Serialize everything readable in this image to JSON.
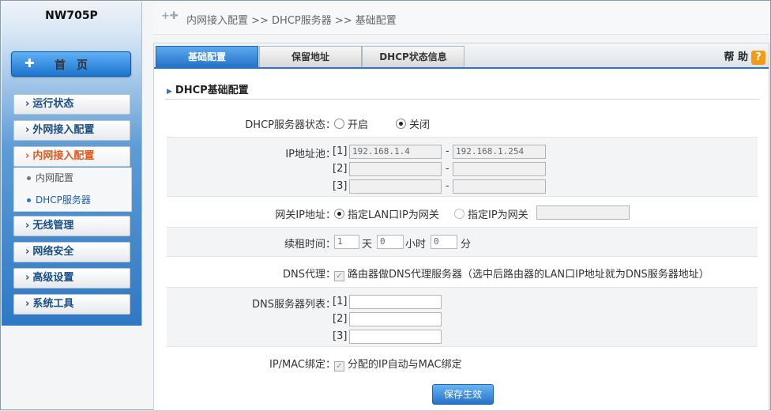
{
  "sidebar": {
    "logo": "NW705P",
    "home": {
      "icon": "plus-icon",
      "label": "首页"
    },
    "items": [
      {
        "label": "运行状态"
      },
      {
        "label": "外网接入配置"
      },
      {
        "label": "内网接入配置"
      },
      {
        "label": "无线管理"
      },
      {
        "label": "网络安全"
      },
      {
        "label": "高级设置"
      },
      {
        "label": "系统工具"
      }
    ],
    "arrow": "›",
    "subitems": [
      {
        "label": "内网配置"
      },
      {
        "label": "DHCP服务器"
      }
    ]
  },
  "breadcrumb": {
    "icon": "+✚",
    "text": "内网接入配置  >>  DHCP服务器  >>  基础配置"
  },
  "tabs": [
    {
      "label": "基础配置"
    },
    {
      "label": "保留地址"
    },
    {
      "label": "DHCP状态信息"
    }
  ],
  "help": {
    "label": "帮 助",
    "icon": "?"
  },
  "section": {
    "title": "DHCP基础配置",
    "tri": "▶"
  },
  "form": {
    "server_status": {
      "label": "DHCP服务器状态：",
      "on": "开启",
      "off": "关闭"
    },
    "ip_pool": {
      "label": "IP地址池：",
      "rows": [
        {
          "index": "[1]",
          "start": "192.168.1.4",
          "end": "192.168.1.254"
        },
        {
          "index": "[2]",
          "start": "",
          "end": ""
        },
        {
          "index": "[3]",
          "start": "",
          "end": ""
        }
      ],
      "sep": "-"
    },
    "gateway": {
      "label": "网关IP地址：",
      "opt1": "指定LAN口IP为网关",
      "opt2": "指定IP为网关",
      "value": ""
    },
    "lease": {
      "label": "续租时间：",
      "days": "1",
      "days_unit": "天",
      "hours": "0",
      "hours_unit": "小时",
      "minutes": "0",
      "minutes_unit": "分"
    },
    "dns_proxy": {
      "label": "DNS代理：",
      "text": "路由器做DNS代理服务器（选中后路由器的LAN口IP地址就为DNS服务器地址）"
    },
    "dns_list": {
      "label": "DNS服务器列表：",
      "rows": [
        {
          "index": "[1]",
          "value": ""
        },
        {
          "index": "[2]",
          "value": ""
        },
        {
          "index": "[3]",
          "value": ""
        }
      ]
    },
    "ipmac": {
      "label": "IP/MAC绑定：",
      "text": "分配的IP自动与MAC绑定"
    }
  },
  "save_label": "保存生效",
  "colors": {
    "accent": "#2473c9",
    "active_nav": "#e0581b",
    "help_badge": "#f29b17"
  }
}
